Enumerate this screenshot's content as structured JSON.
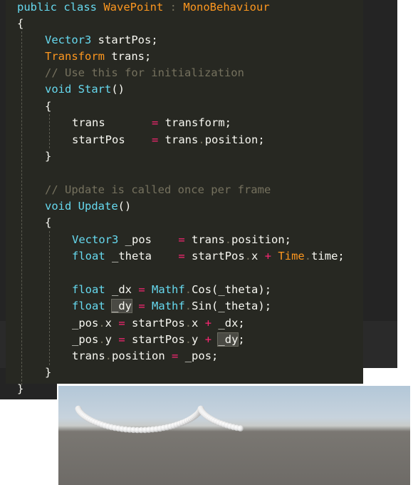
{
  "editor": {
    "colors": {
      "keyword": "#66d9ef",
      "class": "#fd971f",
      "operator": "#f92672",
      "comment": "#75715e",
      "text": "#f8f8f2",
      "background": "#272822"
    },
    "lines": {
      "l1": {
        "kw": "public class",
        "name": "WavePoint",
        "colon": ":",
        "base": "MonoBehaviour"
      },
      "l2": {
        "brace": "{"
      },
      "l3": {
        "type": "Vector3",
        "var": "startPos;"
      },
      "l4": {
        "type": "Transform",
        "var": "trans;"
      },
      "l5": {
        "comment": "// Use this for initialization"
      },
      "l6": {
        "kw": "void",
        "fn": "Start",
        "paren": "()"
      },
      "l7": {
        "brace": "{"
      },
      "l8": {
        "lhs": "trans",
        "op": "=",
        "rhs": "transform;"
      },
      "l9": {
        "lhs": "startPos",
        "op": "=",
        "rhs_a": "trans",
        "rhs_dot": ".",
        "rhs_b": "position;"
      },
      "l10": {
        "brace": "}"
      },
      "l12": {
        "comment": "// Update is called once per frame"
      },
      "l13": {
        "kw": "void",
        "fn": "Update",
        "paren": "()"
      },
      "l14": {
        "brace": "{"
      },
      "l15": {
        "type": "Vector3",
        "var": "_pos",
        "op": "=",
        "rhs_a": "trans",
        "rhs_dot": ".",
        "rhs_b": "position;"
      },
      "l16": {
        "type": "float",
        "var": "_theta",
        "op": "=",
        "rhs_a": "startPos",
        "rhs_dot1": ".",
        "rhs_b": "x",
        "op2": "+",
        "rhs_c": "Time",
        "rhs_dot2": ".",
        "rhs_d": "time;"
      },
      "l18": {
        "type": "float",
        "var": "_dx",
        "op": "=",
        "cls": "Mathf",
        "dot": ".",
        "fn": "Cos(_theta);"
      },
      "l19": {
        "type": "float",
        "var": "_dy",
        "op": "=",
        "cls": "Mathf",
        "dot": ".",
        "fn": "Sin(_theta);"
      },
      "l20": {
        "a": "_pos",
        "dot1": ".",
        "b": "x",
        "op": "=",
        "c": "startPos",
        "dot2": ".",
        "d": "x",
        "op2": "+",
        "e": "_dx;"
      },
      "l21": {
        "a": "_pos",
        "dot1": ".",
        "b": "y",
        "op": "=",
        "c": "startPos",
        "dot2": ".",
        "d": "y",
        "op2": "+",
        "e": "_dy",
        "semi": ";"
      },
      "l22": {
        "a": "trans",
        "dot": ".",
        "b": "position",
        "op": "=",
        "c": "_pos;"
      },
      "l23": {
        "brace": "}"
      },
      "l24": {
        "brace": "}"
      }
    }
  },
  "scene": {
    "description_colors": {
      "sky": "#b3c7d8",
      "ground": "#6e6b67",
      "sphere": "#f0f0f0"
    },
    "sphere_count": 90
  }
}
